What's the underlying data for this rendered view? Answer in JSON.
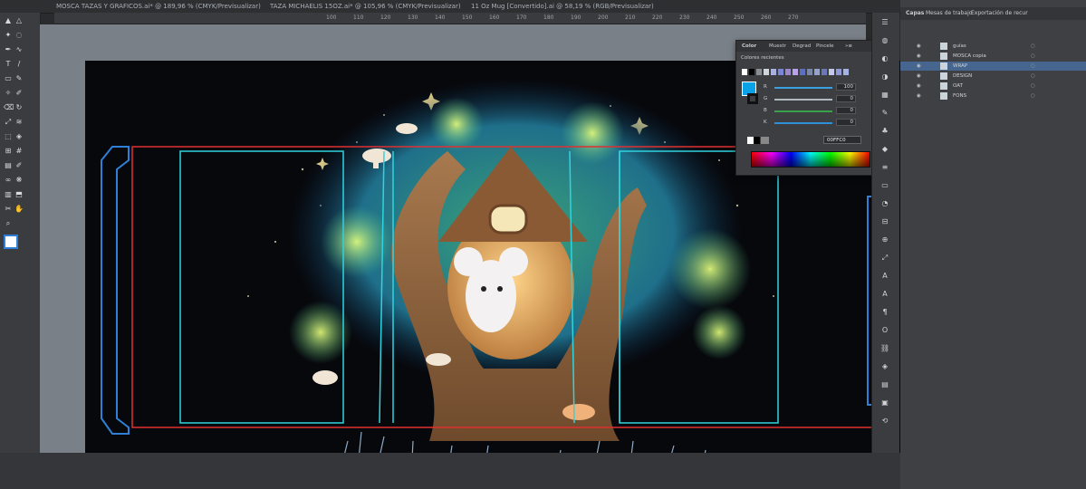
{
  "document_tabs": [
    {
      "label": "MOSCA TAZAS Y GRAFICOS.ai* @ 189,96 % (CMYK/Previsualizar)"
    },
    {
      "label": "TAZA MICHAELIS 15OZ.ai* @ 105,96 % (CMYK/Previsualizar)"
    },
    {
      "label": "11 Oz Mug [Convertido].ai @ 58,19 % (RGB/Previsualizar)"
    }
  ],
  "ruler": {
    "ticks": [
      "100",
      "110",
      "120",
      "130",
      "140",
      "150",
      "160",
      "170",
      "180",
      "190",
      "200",
      "210",
      "220",
      "230",
      "240",
      "250",
      "260",
      "270"
    ]
  },
  "toolbar": {
    "icons": [
      "selection-icon",
      "direct-selection-icon",
      "magic-wand-icon",
      "lasso-icon",
      "pen-icon",
      "curvature-icon",
      "type-icon",
      "line-icon",
      "rectangle-icon",
      "paintbrush-icon",
      "shaper-icon",
      "pencil-icon",
      "eraser-icon",
      "rotate-icon",
      "scale-icon",
      "width-icon",
      "free-transform-icon",
      "shape-builder-icon",
      "perspective-icon",
      "mesh-icon",
      "gradient-icon",
      "eyedropper-icon",
      "blend-icon",
      "symbol-sprayer-icon",
      "graph-icon",
      "artboard-icon",
      "slice-icon",
      "hand-icon",
      "zoom-icon"
    ]
  },
  "color_panel": {
    "tabs": [
      "Color",
      "Muestr",
      "Degrad",
      "Pincele"
    ],
    "recent_label": "Colores recientes",
    "channels": [
      {
        "label": "R",
        "value": "100",
        "color": "#3aa0e0"
      },
      {
        "label": "G",
        "value": "0",
        "color": "#b0b8c0"
      },
      {
        "label": "B",
        "value": "0",
        "color": "#3aa04a"
      },
      {
        "label": "K",
        "value": "0",
        "color": "#2f8fd6"
      }
    ],
    "hex_value": "00FFC0",
    "swatches": [
      "#ffffff",
      "#000000",
      "#8a8f96",
      "#cfd6dc",
      "#a9b0e6",
      "#7a86d6",
      "#9a88c9",
      "#b8a3e8",
      "#5e6fc0",
      "#7788aa",
      "#95a3c8",
      "#6a78b6",
      "#c3c9e8",
      "#8f9ad8",
      "#a6b2e1"
    ]
  },
  "right_column": {
    "icons": [
      "properties-icon",
      "libraries-icon",
      "appearance-icon",
      "color-guide-icon",
      "swatches-icon",
      "brushes-icon",
      "symbols-icon",
      "graphic-styles-icon",
      "stroke-icon",
      "gradient-icon",
      "transparency-icon",
      "align-icon",
      "pathfinder-icon",
      "transform-icon",
      "type-icon",
      "character-icon",
      "paragraph-icon",
      "opentype-icon",
      "links-icon",
      "image-trace-icon",
      "layers-icon",
      "artboards-icon",
      "history-icon"
    ]
  },
  "layers_panel": {
    "tabs": [
      "Capas",
      "Mesas de trabajo",
      "Exportación de recur"
    ],
    "layers": [
      {
        "name": "guías",
        "selected": false
      },
      {
        "name": "MOSCA copia",
        "selected": false
      },
      {
        "name": "WRAP",
        "selected": true
      },
      {
        "name": "DESIGN",
        "selected": false
      },
      {
        "name": "OAT",
        "selected": false
      },
      {
        "name": "FONS",
        "selected": false
      }
    ]
  },
  "colors": {
    "accent_blue": "#2f7fd6",
    "guide_cyan": "#2fd4e0",
    "bleed_red": "#e03030",
    "selection_blue": "#46668f"
  }
}
